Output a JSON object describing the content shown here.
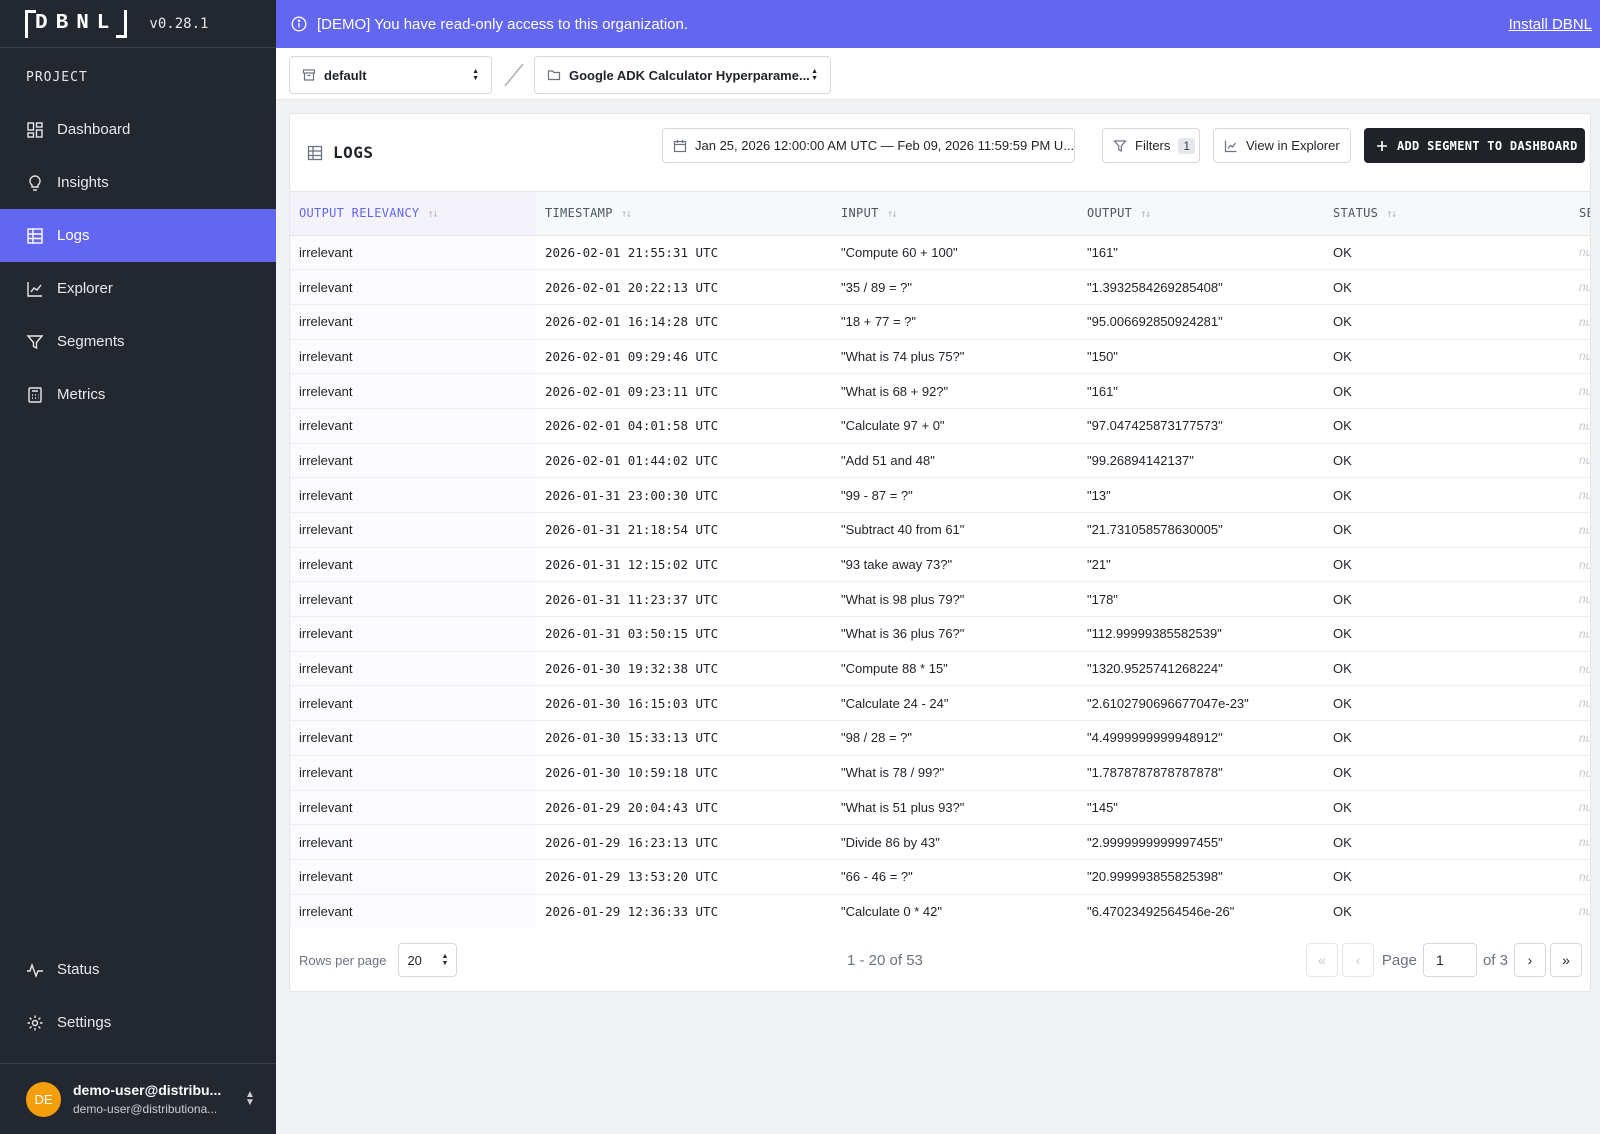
{
  "sidebar": {
    "logo": "DBNL",
    "version": "v0.28.1",
    "section_label": "PROJECT",
    "items": [
      {
        "label": "Dashboard",
        "icon": "dashboard-icon"
      },
      {
        "label": "Insights",
        "icon": "lightbulb-icon"
      },
      {
        "label": "Logs",
        "icon": "table-icon",
        "active": true
      },
      {
        "label": "Explorer",
        "icon": "line-chart-icon"
      },
      {
        "label": "Segments",
        "icon": "filter-icon"
      },
      {
        "label": "Metrics",
        "icon": "calculator-icon"
      }
    ],
    "bottom_items": [
      {
        "label": "Status",
        "icon": "activity-icon"
      },
      {
        "label": "Settings",
        "icon": "gear-icon"
      }
    ],
    "user": {
      "initials": "DE",
      "name": "demo-user@distribu...",
      "email": "demo-user@distributiona..."
    }
  },
  "banner": {
    "text": "[DEMO] You have read-only access to this organization.",
    "link": "Install DBNL"
  },
  "breadcrumb": {
    "namespace": "default",
    "project": "Google ADK Calculator Hyperparame..."
  },
  "panel": {
    "title": "LOGS",
    "date_range": "Jan 25, 2026 12:00:00 AM UTC — Feb 09, 2026 11:59:59 PM U...",
    "filters_label": "Filters",
    "filters_count": "1",
    "view_explorer_label": "View in Explorer",
    "add_segment_label": "ADD SEGMENT TO DASHBOARD"
  },
  "table": {
    "columns": [
      "OUTPUT RELEVANCY",
      "TIMESTAMP",
      "INPUT",
      "OUTPUT",
      "STATUS",
      "SE"
    ],
    "rows": [
      [
        "irrelevant",
        "2026-02-01 21:55:31 UTC",
        "\"Compute 60 + 100\"",
        "\"161\"",
        "OK",
        "nu"
      ],
      [
        "irrelevant",
        "2026-02-01 20:22:13 UTC",
        "\"35 / 89 = ?\"",
        "\"1.3932584269285408\"",
        "OK",
        "nu"
      ],
      [
        "irrelevant",
        "2026-02-01 16:14:28 UTC",
        "\"18 + 77 = ?\"",
        "\"95.006692850924281\"",
        "OK",
        "nu"
      ],
      [
        "irrelevant",
        "2026-02-01 09:29:46 UTC",
        "\"What is 74 plus 75?\"",
        "\"150\"",
        "OK",
        "nu"
      ],
      [
        "irrelevant",
        "2026-02-01 09:23:11 UTC",
        "\"What is 68 + 92?\"",
        "\"161\"",
        "OK",
        "nu"
      ],
      [
        "irrelevant",
        "2026-02-01 04:01:58 UTC",
        "\"Calculate 97 + 0\"",
        "\"97.047425873177573\"",
        "OK",
        "nu"
      ],
      [
        "irrelevant",
        "2026-02-01 01:44:02 UTC",
        "\"Add 51 and 48\"",
        "\"99.26894142137\"",
        "OK",
        "nu"
      ],
      [
        "irrelevant",
        "2026-01-31 23:00:30 UTC",
        "\"99 - 87 = ?\"",
        "\"13\"",
        "OK",
        "nu"
      ],
      [
        "irrelevant",
        "2026-01-31 21:18:54 UTC",
        "\"Subtract 40 from 61\"",
        "\"21.731058578630005\"",
        "OK",
        "nu"
      ],
      [
        "irrelevant",
        "2026-01-31 12:15:02 UTC",
        "\"93 take away 73?\"",
        "\"21\"",
        "OK",
        "nu"
      ],
      [
        "irrelevant",
        "2026-01-31 11:23:37 UTC",
        "\"What is 98 plus 79?\"",
        "\"178\"",
        "OK",
        "nu"
      ],
      [
        "irrelevant",
        "2026-01-31 03:50:15 UTC",
        "\"What is 36 plus 76?\"",
        "\"112.99999385582539\"",
        "OK",
        "nu"
      ],
      [
        "irrelevant",
        "2026-01-30 19:32:38 UTC",
        "\"Compute 88 * 15\"",
        "\"1320.9525741268224\"",
        "OK",
        "nu"
      ],
      [
        "irrelevant",
        "2026-01-30 16:15:03 UTC",
        "\"Calculate 24 - 24\"",
        "\"2.6102790696677047e-23\"",
        "OK",
        "nu"
      ],
      [
        "irrelevant",
        "2026-01-30 15:33:13 UTC",
        "\"98 / 28 = ?\"",
        "\"4.4999999999948912\"",
        "OK",
        "nu"
      ],
      [
        "irrelevant",
        "2026-01-30 10:59:18 UTC",
        "\"What is 78 / 99?\"",
        "\"1.7878787878787878\"",
        "OK",
        "nu"
      ],
      [
        "irrelevant",
        "2026-01-29 20:04:43 UTC",
        "\"What is 51 plus 93?\"",
        "\"145\"",
        "OK",
        "nu"
      ],
      [
        "irrelevant",
        "2026-01-29 16:23:13 UTC",
        "\"Divide 86 by 43\"",
        "\"2.9999999999997455\"",
        "OK",
        "nu"
      ],
      [
        "irrelevant",
        "2026-01-29 13:53:20 UTC",
        "\"66 - 46 = ?\"",
        "\"20.999993855825398\"",
        "OK",
        "nu"
      ],
      [
        "irrelevant",
        "2026-01-29 12:36:33 UTC",
        "\"Calculate 0 * 42\"",
        "\"6.47023492564546e-26\"",
        "OK",
        "nu"
      ]
    ]
  },
  "pagination": {
    "rows_per_page_label": "Rows per page",
    "rows_per_page": "20",
    "range_text": "1 - 20 of 53",
    "page_label": "Page",
    "current_page": "1",
    "of_text": "of 3"
  },
  "colors": {
    "accent": "#6366f1",
    "sidebar_bg": "#23272f",
    "avatar": "#f59e0b"
  }
}
